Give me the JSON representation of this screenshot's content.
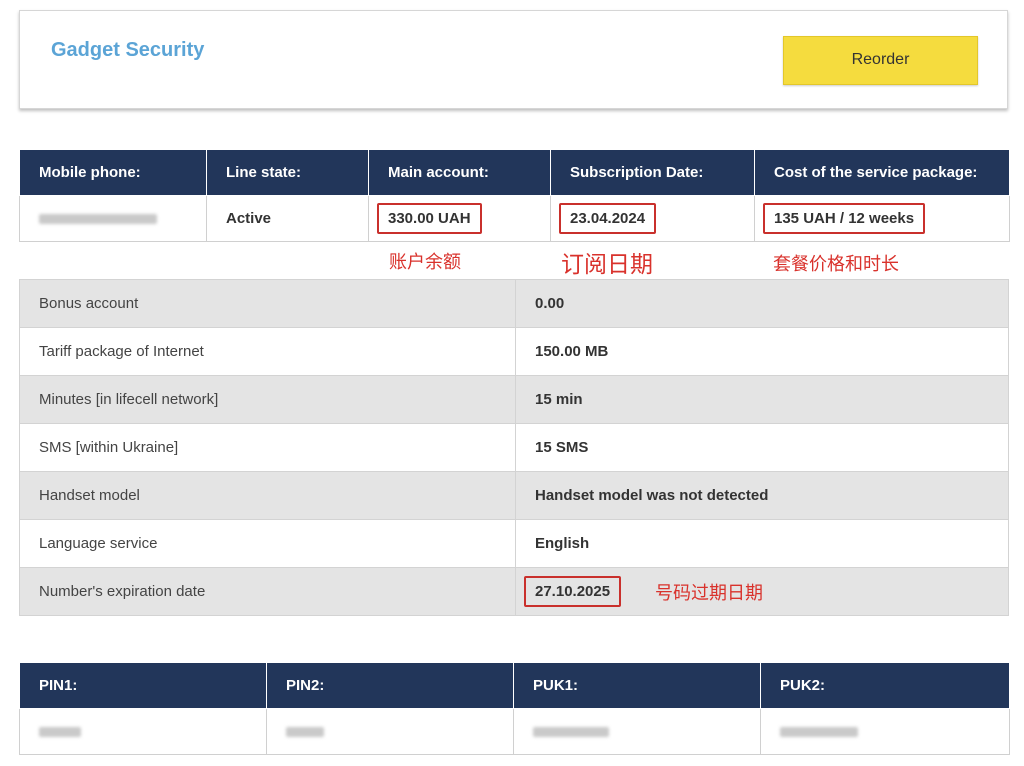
{
  "header": {
    "title": "Gadget Security",
    "reorder_label": "Reorder"
  },
  "summary": {
    "columns": [
      "Mobile phone:",
      "Line state:",
      "Main account:",
      "Subscription Date:",
      "Cost of the service package:"
    ],
    "line_state": "Active",
    "main_account": "330.00 UAH",
    "subscription_date": "23.04.2024",
    "cost": "135 UAH / 12 weeks"
  },
  "annotations": {
    "balance": "账户余额",
    "subscription_date": "订阅日期",
    "package": "套餐价格和时长",
    "expiry": "号码过期日期"
  },
  "details": [
    {
      "label": "Bonus account",
      "value": "0.00"
    },
    {
      "label": "Tariff package of Internet",
      "value": "150.00 MB"
    },
    {
      "label": "Minutes [in lifecell network]",
      "value": "15 min"
    },
    {
      "label": "SMS [within Ukraine]",
      "value": "15 SMS"
    },
    {
      "label": "Handset model",
      "value": "Handset model was not detected"
    },
    {
      "label": "Language service",
      "value": "English"
    },
    {
      "label": "Number's expiration date",
      "value": "27.10.2025"
    }
  ],
  "pins": {
    "columns": [
      "PIN1:",
      "PIN2:",
      "PUK1:",
      "PUK2:"
    ]
  },
  "colors": {
    "title_blue": "#5ba4d6",
    "button_yellow": "#f5dc3e",
    "header_navy": "#22365a",
    "annotation_red": "#d9322c"
  }
}
